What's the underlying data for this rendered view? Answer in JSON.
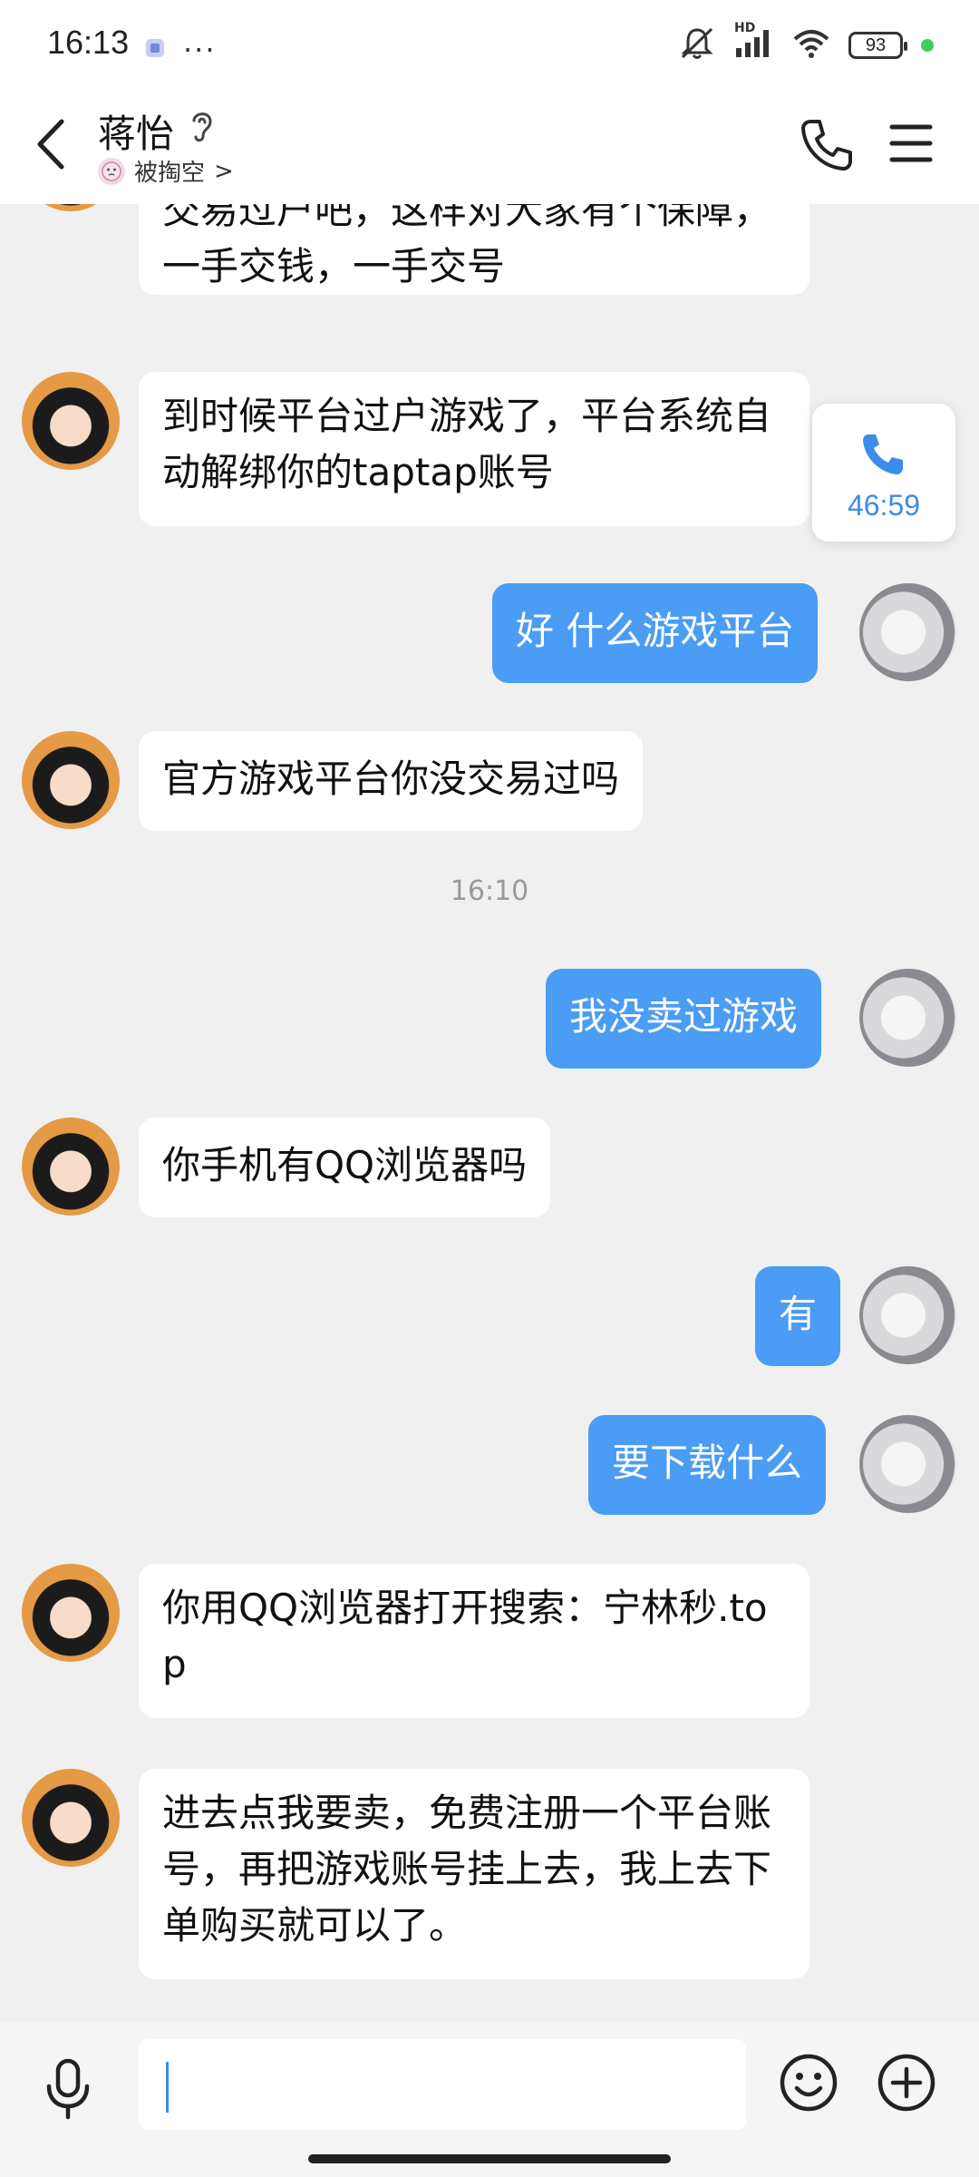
{
  "status_bar": {
    "time": "16:13",
    "more": "···",
    "network": "HD",
    "battery": "93"
  },
  "header": {
    "contact_name": "蒋怡",
    "contact_status": "被掏空",
    "status_chevron": ">"
  },
  "call_card": {
    "duration": "46:59"
  },
  "messages": [
    {
      "from": "her",
      "text": "交易过户吧，这样对大家有个保障，一手交钱，一手交号"
    },
    {
      "from": "her",
      "text": "到时候平台过户游戏了，平台系统自动解绑你的taptap账号"
    },
    {
      "from": "me",
      "text": "好 什么游戏平台"
    },
    {
      "from": "her",
      "text": "官方游戏平台你没交易过吗"
    },
    {
      "from": "me",
      "text": "我没卖过游戏"
    },
    {
      "from": "her",
      "text": "你手机有QQ浏览器吗"
    },
    {
      "from": "me",
      "text": "有"
    },
    {
      "from": "me",
      "text": "要下载什么"
    },
    {
      "from": "her",
      "text": "你用QQ浏览器打开搜索：宁林秒.top"
    },
    {
      "from": "her",
      "text": "进去点我要卖，免费注册一个平台账号，再把游戏账号挂上去，我上去下单购买就可以了。"
    }
  ],
  "time_separator": "16:10",
  "input": {
    "value": ""
  },
  "colors": {
    "my_bubble": "#4a9cf4",
    "their_bubble": "#ffffff",
    "accent": "#3a8de8"
  }
}
